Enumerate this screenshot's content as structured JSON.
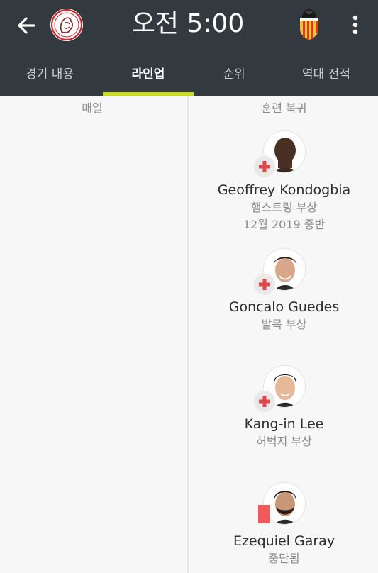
{
  "header": {
    "time": "오전 5:00",
    "home_team_logo": "ajax-crest",
    "away_team_logo": "valencia-crest",
    "background_color": "#323a40",
    "accent_color": "#c6d730"
  },
  "tabs": [
    {
      "label": "경기 내용",
      "active": false
    },
    {
      "label": "라인업",
      "active": true
    },
    {
      "label": "순위",
      "active": false
    },
    {
      "label": "역대 전적",
      "active": false
    }
  ],
  "columns": {
    "left_label": "매일",
    "right_label": "훈련 복귀"
  },
  "players": [
    {
      "name": "Geoffrey Kondogbia",
      "note": "햄스트링 부상",
      "note2": "12월 2019 중반",
      "status_icon": "injury-cross-icon"
    },
    {
      "name": "Goncalo Guedes",
      "note": "발목 부상",
      "status_icon": "injury-cross-icon"
    },
    {
      "name": "Kang-in Lee",
      "note": "허벅지 부상",
      "status_icon": "injury-cross-icon"
    },
    {
      "name": "Ezequiel Garay",
      "note": "중단됨",
      "status_icon": "red-card-icon"
    }
  ],
  "status_colors": {
    "injury": "#e04848",
    "red_card": "#f05a5a"
  }
}
